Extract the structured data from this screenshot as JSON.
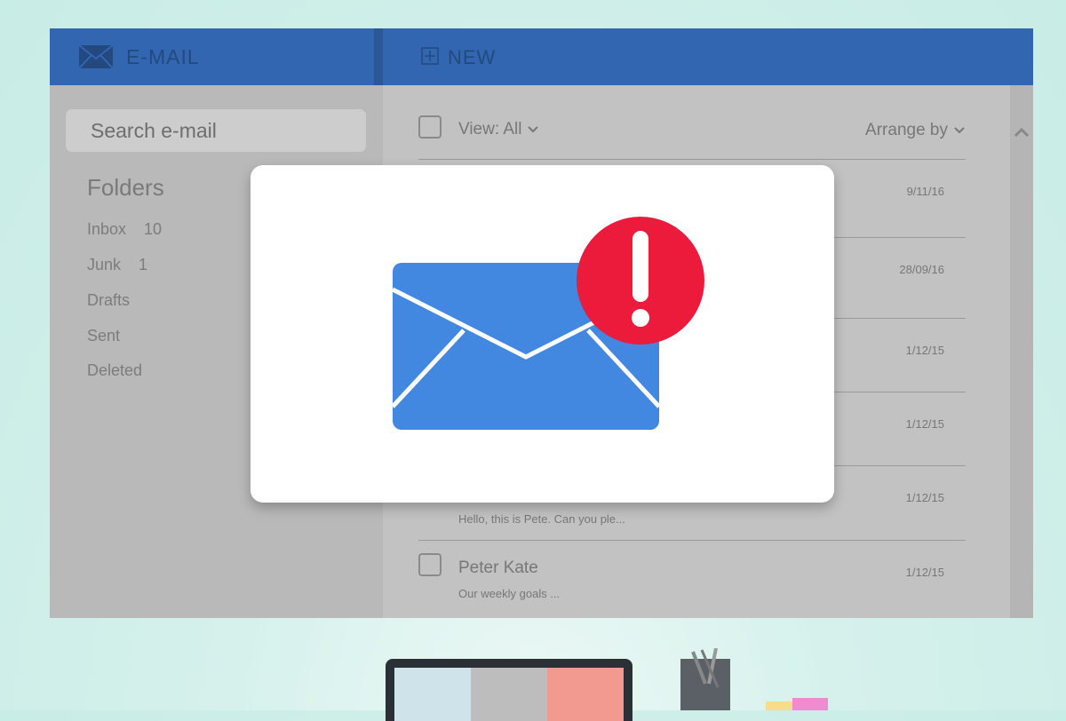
{
  "app": {
    "title": "E-MAIL",
    "new_label": "NEW",
    "colors": {
      "topbar": "#3366b0",
      "alert": "#ec1a3b",
      "envelope": "#4287e0"
    }
  },
  "search": {
    "placeholder": "Search e-mail"
  },
  "folders": {
    "title": "Folders",
    "items": [
      {
        "label": "Inbox",
        "count": "10"
      },
      {
        "label": "Junk",
        "count": "1"
      },
      {
        "label": "Drafts",
        "count": ""
      },
      {
        "label": "Sent",
        "count": ""
      },
      {
        "label": "Deleted",
        "count": ""
      }
    ]
  },
  "list": {
    "view_label": "View: All",
    "arrange_label": "Arrange by",
    "rows": [
      {
        "name": "",
        "preview": "",
        "date": "9/11/16"
      },
      {
        "name": "",
        "preview": "",
        "date": "28/09/16"
      },
      {
        "name": "",
        "preview": "",
        "date": "1/12/15"
      },
      {
        "name": "",
        "preview": "",
        "date": "1/12/15"
      },
      {
        "name": "",
        "preview": "Hello, this is Pete. Can you ple...",
        "date": "1/12/15"
      },
      {
        "name": "Peter Kate",
        "preview": "Our weekly goals ...",
        "date": "1/12/15"
      }
    ]
  },
  "modal": {
    "icon": "envelope-alert-icon"
  },
  "icons": {
    "brand": "envelope-icon",
    "new": "plus-square-icon",
    "dropdown": "chevron-down-icon",
    "scroll": "chevron-up-icon"
  }
}
